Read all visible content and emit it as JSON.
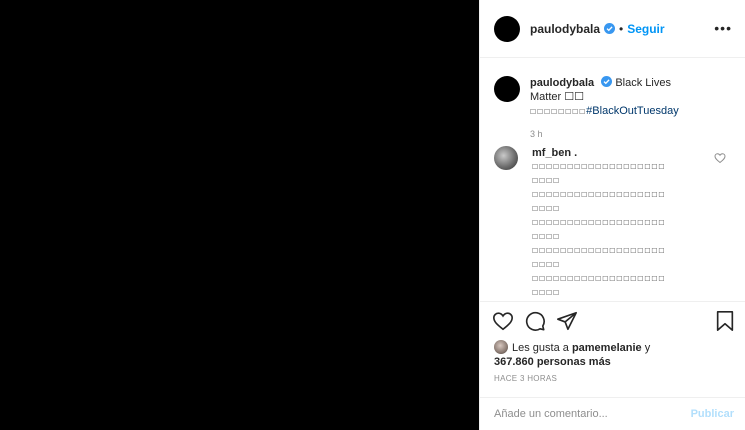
{
  "header": {
    "username": "paulodybala",
    "separator": "•",
    "follow_label": "Seguir",
    "more_label": "•••"
  },
  "caption": {
    "username": "paulodybala",
    "text": "Black Lives Matter ☐☐",
    "text_line2": "☐☐☐☐☐☐☐☐",
    "hashtag": "#BlackOutTuesday",
    "time": "3 h"
  },
  "comment": {
    "username": "mf_ben .",
    "lines": [
      "☐☐☐☐☐☐☐☐☐☐☐☐☐☐☐☐☐☐☐",
      "☐☐☐☐",
      "☐☐☐☐☐☐☐☐☐☐☐☐☐☐☐☐☐☐☐",
      "☐☐☐☐",
      "☐☐☐☐☐☐☐☐☐☐☐☐☐☐☐☐☐☐☐",
      "☐☐☐☐",
      "☐☐☐☐☐☐☐☐☐☐☐☐☐☐☐☐☐☐☐",
      "☐☐☐☐",
      "☐☐☐☐☐☐☐☐☐☐☐☐☐☐☐☐☐☐☐",
      "☐☐☐☐"
    ]
  },
  "likes": {
    "prefix": "Les gusta a ",
    "user": "pamemelanie",
    "conj": " y",
    "count_text": "367.860 personas más"
  },
  "time_ago": "HACE 3 HORAS",
  "add_comment": {
    "placeholder": "Añade un comentario...",
    "publish_label": "Publicar"
  },
  "icons": {
    "like": "heart-icon",
    "comment": "comment-icon",
    "share": "share-icon",
    "save": "bookmark-icon",
    "verified": "verified-badge-icon"
  },
  "colors": {
    "link": "#0095f6",
    "hashtag": "#00376b",
    "muted": "#8e8e8e",
    "publish_disabled": "#b2dffc",
    "verified": "#3897f0"
  }
}
